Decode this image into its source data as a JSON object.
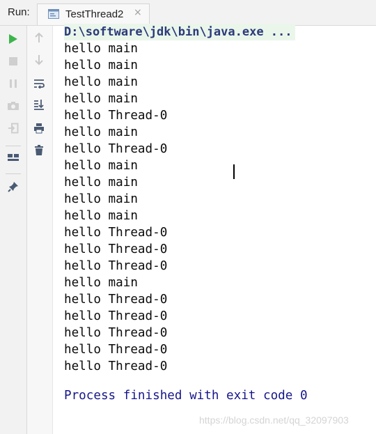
{
  "header": {
    "run_label": "Run:",
    "tab_title": "TestThread2",
    "close_glyph": "×"
  },
  "toolbar_left": [
    {
      "icon": "run-icon"
    },
    {
      "icon": "stop-icon"
    },
    {
      "icon": "pause-icon"
    },
    {
      "icon": "camera-icon"
    },
    {
      "icon": "exit-icon"
    },
    {
      "icon": "layout-icon"
    },
    {
      "icon": "pin-icon"
    }
  ],
  "toolbar_right": [
    {
      "icon": "up-arrow-icon"
    },
    {
      "icon": "down-arrow-icon"
    },
    {
      "icon": "soft-wrap-icon"
    },
    {
      "icon": "scroll-to-end-icon"
    },
    {
      "icon": "print-icon"
    },
    {
      "icon": "trash-icon"
    }
  ],
  "console": {
    "command": "D:\\software\\jdk\\bin\\java.exe ...",
    "lines": [
      "hello main",
      "hello main",
      "hello main",
      "hello main",
      "hello Thread-0",
      "hello main",
      "hello Thread-0",
      "hello main",
      "hello main",
      "hello main",
      "hello main",
      "hello Thread-0",
      "hello Thread-0",
      "hello Thread-0",
      "hello main",
      "hello Thread-0",
      "hello Thread-0",
      "hello Thread-0",
      "hello Thread-0",
      "hello Thread-0"
    ],
    "finish_message": "Process finished with exit code 0"
  },
  "watermark": "https://blog.csdn.net/qq_32097903",
  "colors": {
    "run_green": "#3bb54a",
    "finish_blue": "#17178a",
    "command_bg": "#eaf6ea"
  }
}
